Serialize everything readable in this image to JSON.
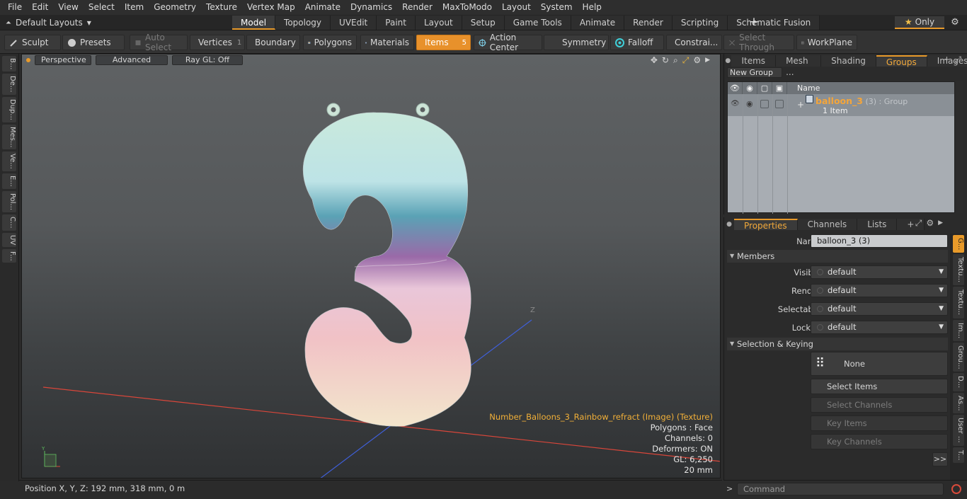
{
  "menubar": [
    "File",
    "Edit",
    "View",
    "Select",
    "Item",
    "Geometry",
    "Texture",
    "Vertex Map",
    "Animate",
    "Dynamics",
    "Render",
    "MaxToModo",
    "Layout",
    "System",
    "Help"
  ],
  "layouts": {
    "label": "Default Layouts",
    "tabs": [
      "Model",
      "Topology",
      "UVEdit",
      "Paint",
      "Layout",
      "Setup",
      "Game Tools",
      "Animate",
      "Render",
      "Scripting",
      "Schematic Fusion"
    ],
    "active_tab": "Model",
    "only_label": "Only"
  },
  "toolbar": {
    "sculpt": "Sculpt",
    "presets": "Presets",
    "auto_select": "Auto Select",
    "vertices": "Vertices",
    "vertices_count": "1",
    "boundary": "Boundary",
    "polygons": "Polygons",
    "materials": "Materials",
    "items": "Items",
    "items_count": "5",
    "action_center": "Action Center",
    "symmetry": "Symmetry",
    "falloff": "Falloff",
    "constraints": "Constrai...",
    "select_through": "Select Through",
    "workplane": "WorkPlane"
  },
  "left_strip": [
    "B...",
    "De...",
    "Dup...",
    "Mes...",
    "Ve...",
    "E...",
    "Pol...",
    "C...",
    "UV",
    "F..."
  ],
  "viewport": {
    "view_mode": "Perspective",
    "shading": "Advanced",
    "raygl": "Ray GL: Off",
    "info": {
      "texture": "Number_Balloons_3_Rainbow_refract (Image) (Texture)",
      "polygons": "Polygons : Face",
      "channels": "Channels: 0",
      "deformers": "Deformers: ON",
      "gl": "GL: 6,250",
      "scale": "20 mm"
    }
  },
  "status": {
    "position": "Position X, Y, Z:   192 mm, 318 mm, 0 m"
  },
  "groups_panel": {
    "tabs": [
      "Items",
      "Mesh ...",
      "Shading",
      "Groups",
      "Images"
    ],
    "active_tab": "Groups",
    "new_group": "New Group",
    "column_name": "Name",
    "group_name": "balloon_3",
    "group_type": " (3) : Group",
    "group_sub": "1 Item"
  },
  "properties": {
    "tabs": [
      "Properties",
      "Channels",
      "Lists"
    ],
    "active_tab": "Properties",
    "name_label": "Name",
    "name_value": "balloon_3 (3)",
    "members_label": "Members",
    "visible_label": "Visible",
    "visible_value": "default",
    "render_label": "Render",
    "render_value": "default",
    "selectable_label": "Selectable",
    "selectable_value": "default",
    "locked_label": "Locked",
    "locked_value": "default",
    "selection_label": "Selection & Keying",
    "none_label": "None",
    "select_items": "Select Items",
    "select_channels": "Select Channels",
    "key_items": "Key Items",
    "key_channels": "Key Channels",
    "expand": ">>"
  },
  "right_vtabs": [
    "G...",
    "Textu...",
    "Textu...",
    "Im...",
    "Grou...",
    "D...",
    "As...",
    "User ...",
    "T..."
  ],
  "command": {
    "placeholder": "Command",
    "prompt": ">"
  },
  "colors": {
    "accent": "#e89a2a",
    "texture_label": "#f2b038",
    "group_name": "#f4a53a"
  }
}
